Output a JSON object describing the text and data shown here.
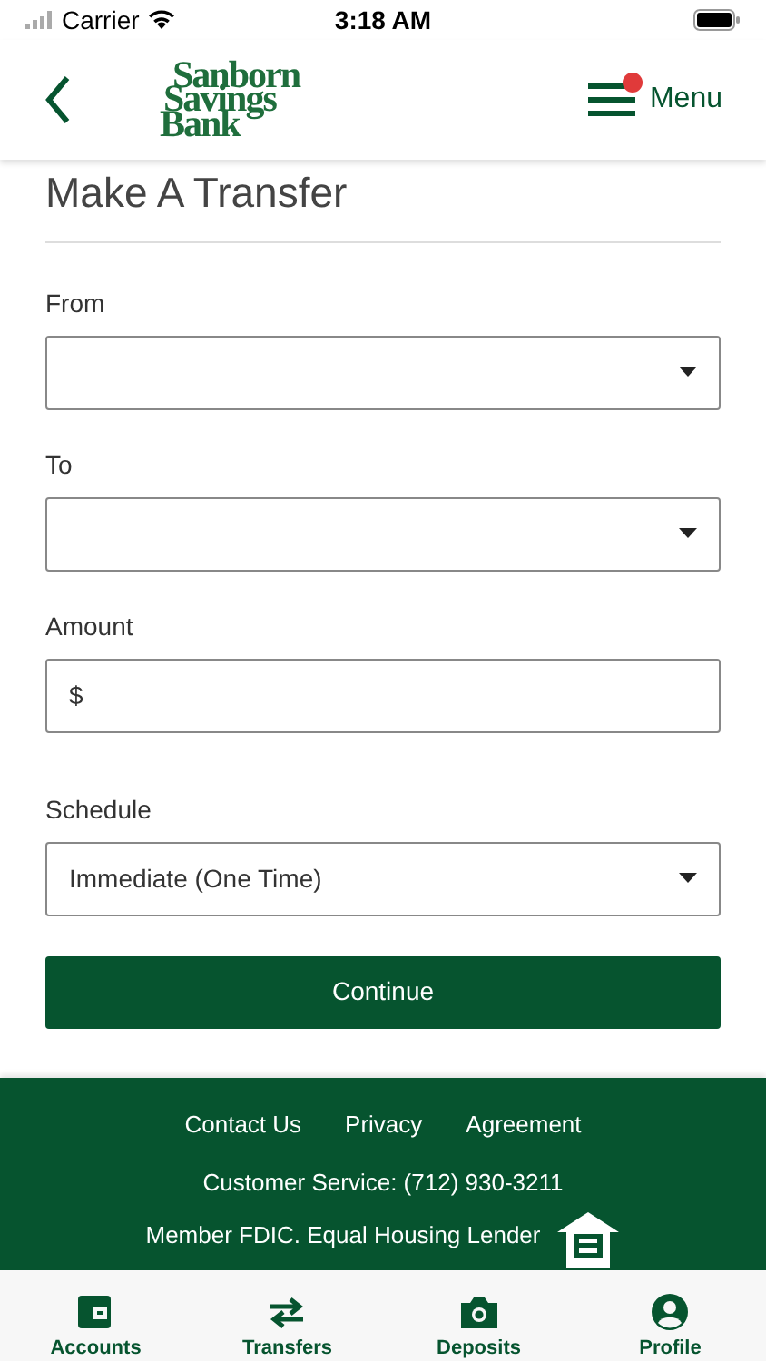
{
  "status_bar": {
    "carrier": "Carrier",
    "time": "3:18 AM"
  },
  "header": {
    "logo": [
      "Sanborn",
      "Savings",
      "Bank"
    ],
    "menu_label": "Menu",
    "menu_alert": true
  },
  "title": "Make A Transfer",
  "fields": [
    {
      "label": "From",
      "kind": "select"
    },
    {
      "label": "To",
      "kind": "select"
    },
    {
      "label": "Amount",
      "kind": "input",
      "prefix": "$"
    },
    {
      "label": "Schedule",
      "kind": "select",
      "value": "Immediate (One Time)"
    }
  ],
  "continue_button": "Continue",
  "footer": {
    "links": [
      "Contact Us",
      "Privacy",
      "Agreement"
    ],
    "service": "Customer Service: (712) 930-3211",
    "member": "Member FDIC. Equal Housing Lender"
  },
  "tab_bar": [
    {
      "label": "Accounts",
      "kind": "wallet"
    },
    {
      "label": "Transfers",
      "kind": "arrows"
    },
    {
      "label": "Deposits",
      "kind": "camera"
    },
    {
      "label": "Profile",
      "kind": "person"
    }
  ]
}
